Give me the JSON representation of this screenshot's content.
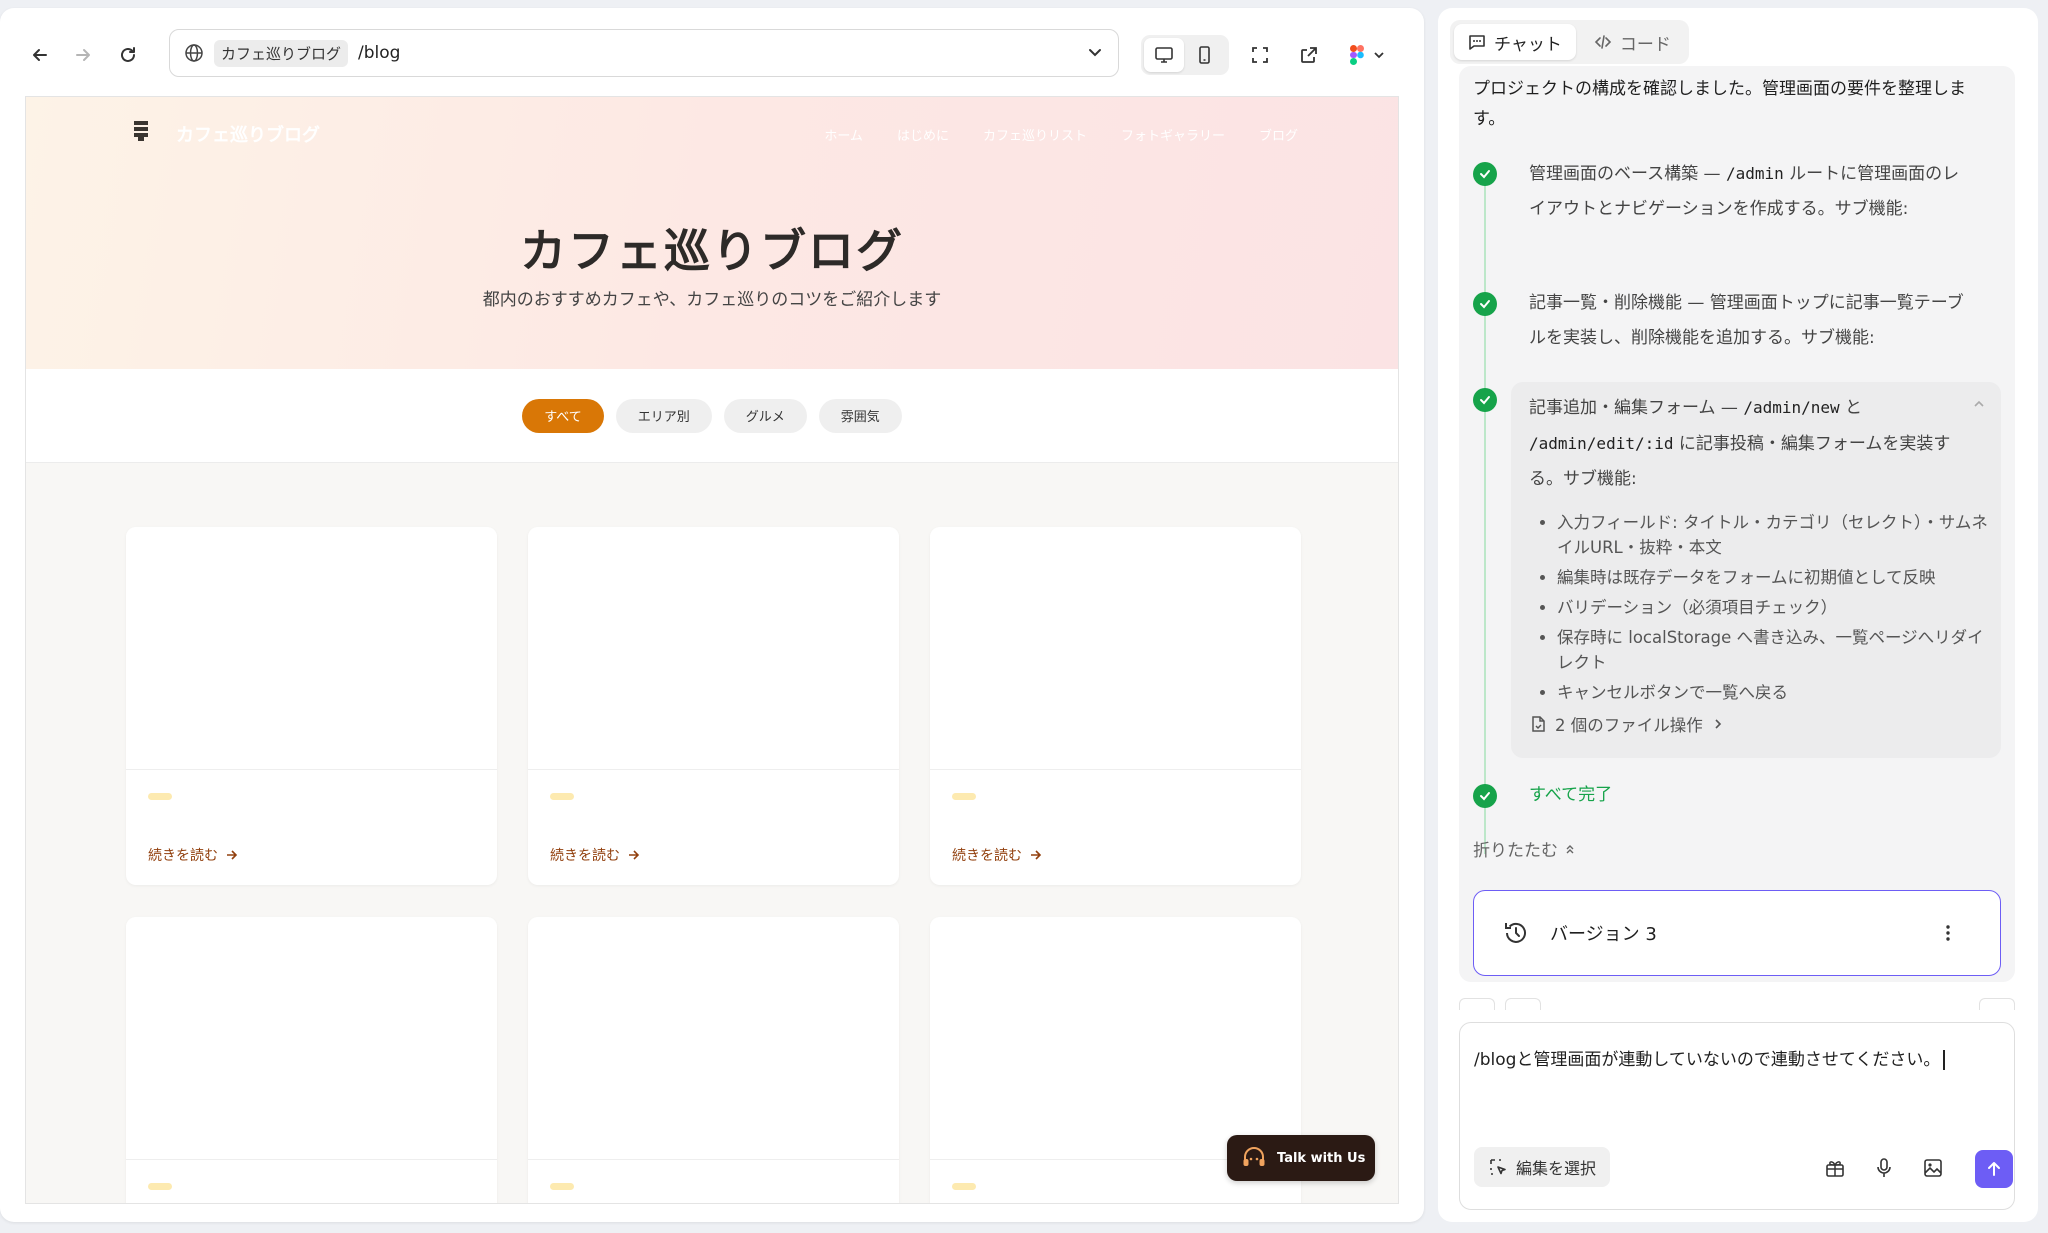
{
  "browser": {
    "url_chip": "カフェ巡りブログ",
    "url_path": "/blog"
  },
  "site": {
    "logo_text": "カフェ巡りブログ",
    "nav": [
      "ホーム",
      "はじめに",
      "カフェ巡りリスト",
      "フォトギャラリー",
      "ブログ"
    ],
    "hero_title": "カフェ巡りブログ",
    "hero_subtitle": "都内のおすすめカフェや、カフェ巡りのコツをご紹介します",
    "filters": [
      "すべて",
      "エリア別",
      "グルメ",
      "雰囲気"
    ],
    "read_more": "続きを読む",
    "talk_button": "Talk with Us"
  },
  "colors": {
    "accent": "#d97706",
    "link": "#92400e",
    "success": "#16a34a",
    "brand_purple": "#6d5df5"
  },
  "chat": {
    "tabs": [
      "チャット",
      "コード"
    ],
    "intro": "プロジェクトの構成を確認しました。管理画面の要件を整理します。",
    "step1": {
      "pre": "管理画面のベース構築 — ",
      "code": "/admin",
      "post": " ルートに管理画面のレイアウトとナビゲーションを作成する。サブ機能:"
    },
    "step2": "記事一覧・削除機能 — 管理画面トップに記事一覧テーブルを実装し、削除機能を追加する。サブ機能:",
    "step3": {
      "pre": "記事追加・編集フォーム — ",
      "code1": "/admin/new",
      "mid": " と ",
      "code2": "/admin/edit/:id",
      "post": " に記事投稿・編集フォームを実装する。サブ機能:",
      "items": [
        "入力フィールド: タイトル・カテゴリ（セレクト）・サムネイルURL・抜粋・本文",
        "編集時は既存データをフォームに初期値として反映",
        "バリデーション（必須項目チェック）",
        "保存時に localStorage へ書き込み、一覧ページへリダイレクト",
        "キャンセルボタンで一覧へ戻る"
      ],
      "file_ops": "2 個のファイル操作"
    },
    "done": "すべて完了",
    "collapse": "折りたたむ",
    "version": "バージョン 3",
    "composer_text": "/blogと管理画面が連動していないので連動させてください。",
    "select_edit": "編集を選択"
  }
}
